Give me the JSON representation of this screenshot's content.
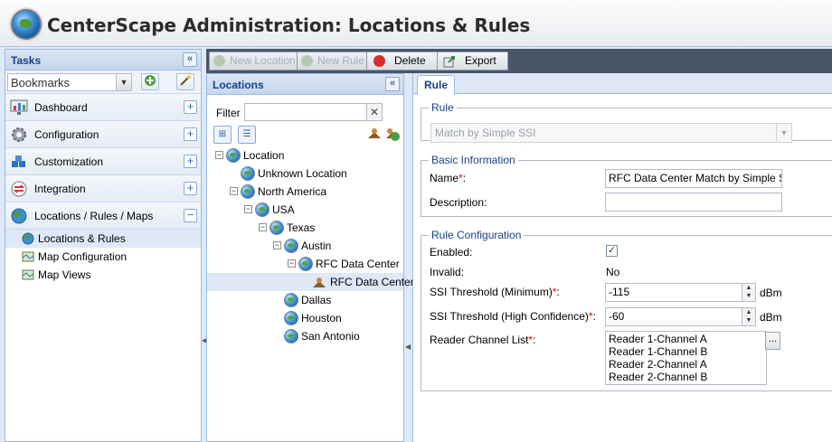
{
  "header": {
    "title": "CenterScape Administration: Locations & Rules"
  },
  "tasks": {
    "title": "Tasks",
    "bookmarks_value": "Bookmarks",
    "sections": [
      {
        "label": "Dashboard",
        "expander": "+"
      },
      {
        "label": "Configuration",
        "expander": "+"
      },
      {
        "label": "Customization",
        "expander": "+"
      },
      {
        "label": "Integration",
        "expander": "+"
      },
      {
        "label": "Locations / Rules / Maps",
        "expander": "−"
      }
    ],
    "sub_items": [
      {
        "label": "Locations & Rules",
        "selected": true
      },
      {
        "label": "Map Configuration",
        "selected": false
      },
      {
        "label": "Map Views",
        "selected": false
      }
    ]
  },
  "toolbar": {
    "new_location": "New Location",
    "new_rule": "New Rule",
    "delete": "Delete",
    "export": "Export"
  },
  "locations": {
    "title": "Locations",
    "filter_label": "Filter",
    "filter_value": "",
    "clear": "✕",
    "tree": [
      {
        "label": "Location",
        "depth": 0,
        "expander": "−"
      },
      {
        "label": "Unknown Location",
        "depth": 1,
        "expander": ""
      },
      {
        "label": "North America",
        "depth": 1,
        "expander": "−"
      },
      {
        "label": "USA",
        "depth": 2,
        "expander": "−"
      },
      {
        "label": "Texas",
        "depth": 3,
        "expander": "−"
      },
      {
        "label": "Austin",
        "depth": 4,
        "expander": "−"
      },
      {
        "label": "RFC Data Center",
        "depth": 5,
        "expander": "−"
      },
      {
        "label": "RFC Data Center",
        "depth": 6,
        "expander": "",
        "type": "rule",
        "selected": true
      },
      {
        "label": "Dallas",
        "depth": 4,
        "expander": ""
      },
      {
        "label": "Houston",
        "depth": 4,
        "expander": ""
      },
      {
        "label": "San Antonio",
        "depth": 4,
        "expander": ""
      }
    ]
  },
  "rule": {
    "tab": "Rule",
    "rule_legend": "Rule",
    "rule_type": "Match by Simple SSI",
    "basic_legend": "Basic Information",
    "name_label": "Name",
    "name_value": "RFC Data Center Match by Simple SSI",
    "description_label": "Description:",
    "description_value": "",
    "config_legend": "Rule Configuration",
    "enabled_label": "Enabled:",
    "enabled_value": "✓",
    "invalid_label": "Invalid:",
    "invalid_value": "No",
    "ssi_min_label": "SSI Threshold (Minimum)",
    "ssi_min_value": "-115",
    "ssi_high_label": "SSI Threshold (High Confidence)",
    "ssi_high_value": "-60",
    "unit": "dBm",
    "channel_label": "Reader Channel List",
    "channels": [
      "Reader 1-Channel A",
      "Reader 1-Channel B",
      "Reader 2-Channel A",
      "Reader 2-Channel B"
    ],
    "dots": "..."
  },
  "colors": {
    "accent": "#15428b",
    "panel_border": "#99bbe8",
    "toolbar_bg": "#4a5668",
    "selected_bg": "#dfe8f6"
  }
}
